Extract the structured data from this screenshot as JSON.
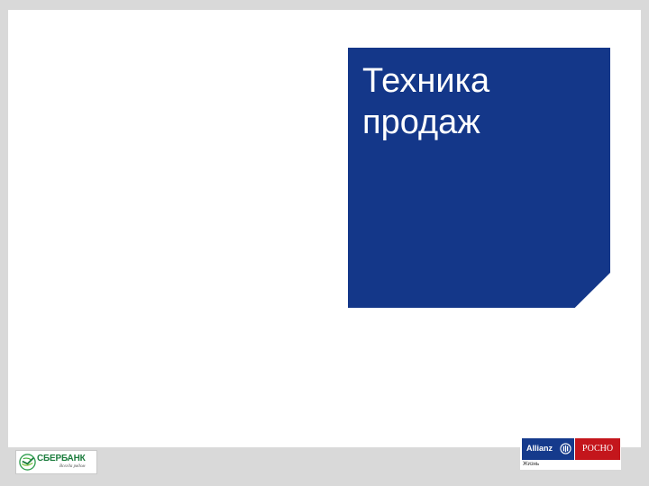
{
  "slide": {
    "title": "Техника\nпродаж"
  },
  "logos": {
    "sberbank": {
      "name": "СБЕРБАНК",
      "tagline": "Всегда рядом",
      "icon": "sberbank-emblem-icon"
    },
    "allianz": {
      "name": "Allianz",
      "partner": "РОСНО",
      "sub": "Жизнь",
      "icon": "allianz-eagle-icon"
    }
  },
  "colors": {
    "title_block": "#143789",
    "sber_green": "#1d7d3e",
    "allianz_blue": "#153a8c",
    "rosno_red": "#c4161c",
    "frame": "#d9d9d9"
  }
}
